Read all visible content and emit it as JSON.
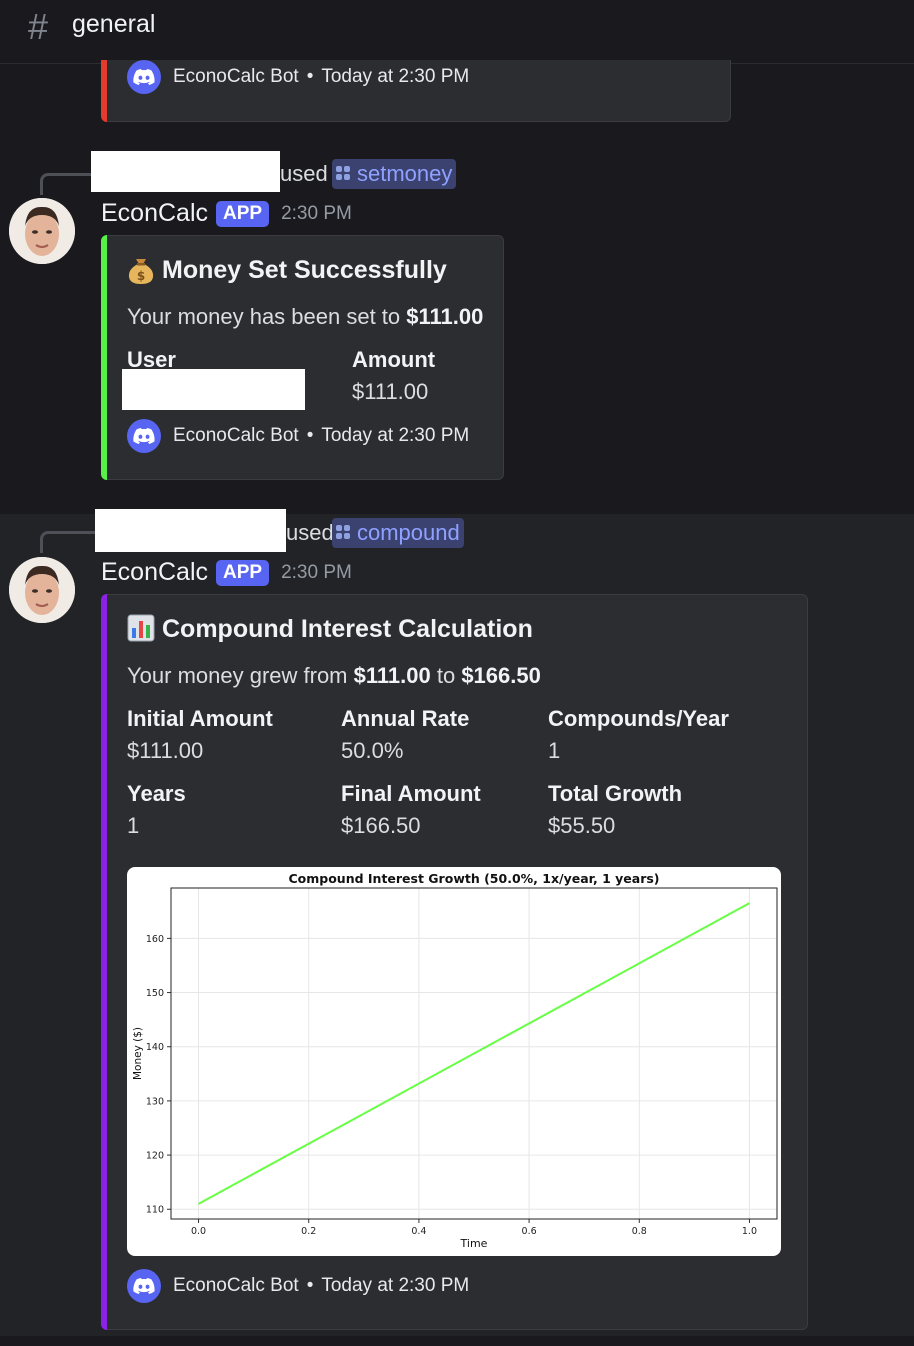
{
  "channel": {
    "name": "general"
  },
  "embed_prev": {
    "footer": {
      "bot_name": "EconoCalc Bot",
      "timestamp": "Today at 2:30 PM"
    },
    "color": "#e53a2e"
  },
  "msg1": {
    "used_text": "used",
    "command": "setmoney",
    "author": "EconCalc",
    "badge": "APP",
    "time": "2:30 PM",
    "embed": {
      "color": "#57f14a",
      "title": "Money Set Successfully",
      "title_emoji": "money-bag-icon",
      "desc_prefix": "Your money has been set to ",
      "desc_amount": "$111.00",
      "fields": [
        {
          "name": "User",
          "value": ""
        },
        {
          "name": "Amount",
          "value": "$111.00"
        }
      ],
      "footer": {
        "bot_name": "EconoCalc Bot",
        "timestamp": "Today at 2:30 PM"
      }
    }
  },
  "msg2": {
    "used_text": "used",
    "command": "compound",
    "author": "EconCalc",
    "badge": "APP",
    "time": "2:30 PM",
    "embed": {
      "color": "#8b22e6",
      "title": "Compound Interest Calculation",
      "title_emoji": "bar-chart-icon",
      "desc_prefix": "Your money grew from ",
      "desc_from": "$111.00",
      "desc_mid": " to ",
      "desc_to": "$166.50",
      "fields": [
        {
          "name": "Initial Amount",
          "value": "$111.00"
        },
        {
          "name": "Annual Rate",
          "value": "50.0%"
        },
        {
          "name": "Compounds/Year",
          "value": "1"
        },
        {
          "name": "Years",
          "value": "1"
        },
        {
          "name": "Final Amount",
          "value": "$166.50"
        },
        {
          "name": "Total Growth",
          "value": "$55.50"
        }
      ],
      "footer": {
        "bot_name": "EconoCalc Bot",
        "timestamp": "Today at 2:30 PM"
      }
    }
  },
  "chart_data": {
    "type": "line",
    "title": "Compound Interest Growth (50.0%, 1x/year, 1 years)",
    "xlabel": "Time",
    "ylabel": "Money ($)",
    "xlim": [
      -0.05,
      1.05
    ],
    "ylim": [
      108.2,
      169.3
    ],
    "xticks": [
      "0.0",
      "0.2",
      "0.4",
      "0.6",
      "0.8",
      "1.0"
    ],
    "yticks": [
      "110",
      "120",
      "130",
      "140",
      "150",
      "160"
    ],
    "grid": true,
    "series": [
      {
        "color": "#66ff44",
        "x": [
          0.0,
          1.0
        ],
        "y": [
          111.0,
          166.5
        ]
      }
    ]
  }
}
